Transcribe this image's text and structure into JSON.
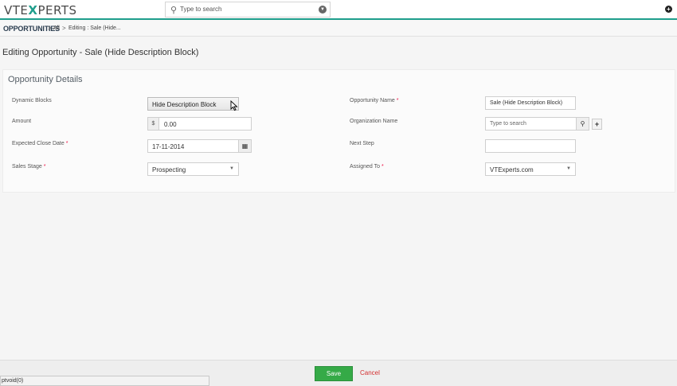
{
  "header": {
    "logo": {
      "part1": "VTE",
      "part2": "X",
      "part3": "PERTS"
    },
    "search_placeholder": "Type to search"
  },
  "breadcrumb": {
    "module": "OPPORTUNITIES",
    "separator": ">",
    "all": "All",
    "current": "Editing : Sale (Hide..."
  },
  "page_title": "Editing Opportunity - Sale (Hide Description Block)",
  "section_title": "Opportunity Details",
  "fields": {
    "dynamic_blocks": {
      "label": "Dynamic Blocks",
      "value": "Hide Description Block"
    },
    "amount": {
      "label": "Amount",
      "currency": "$",
      "value": "0.00"
    },
    "expected_close_date": {
      "label": "Expected Close Date",
      "value": "17-11-2014"
    },
    "sales_stage": {
      "label": "Sales Stage",
      "value": "Prospecting"
    },
    "opportunity_name": {
      "label": "Opportunity Name",
      "value": "Sale (Hide Description Block)"
    },
    "organization_name": {
      "label": "Organization Name",
      "placeholder": "Type to search"
    },
    "next_step": {
      "label": "Next Step",
      "value": ""
    },
    "assigned_to": {
      "label": "Assigned To",
      "value": "VTExperts.com"
    }
  },
  "required_mark": "*",
  "footer": {
    "save": "Save",
    "cancel": "Cancel"
  },
  "status_bar": "ptvoid(0)",
  "colors": {
    "accent": "#1f9e8c",
    "save": "#35aa47",
    "cancel": "#d32f2f",
    "required": "#e14"
  }
}
